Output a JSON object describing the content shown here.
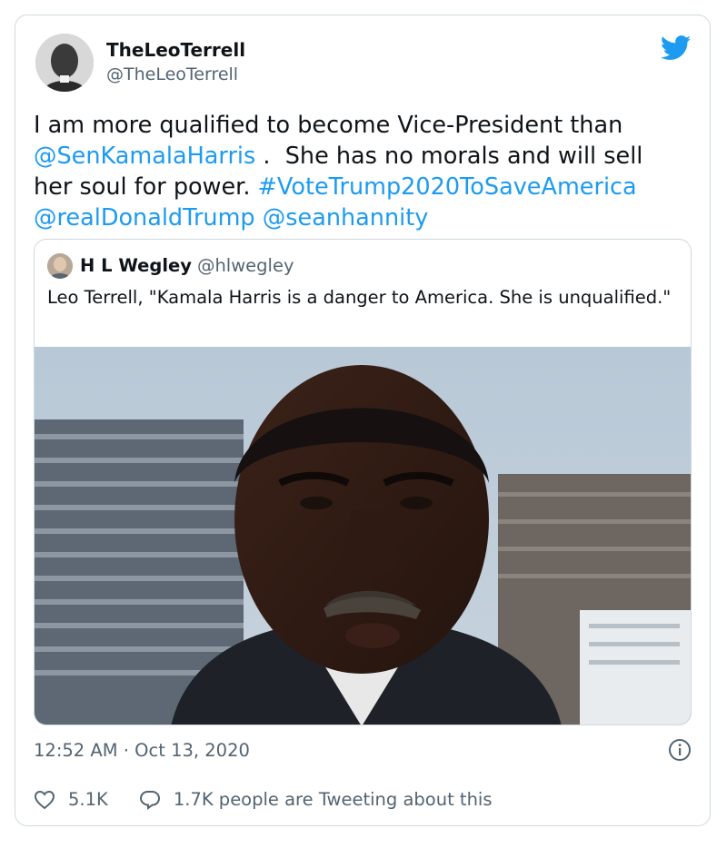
{
  "author": {
    "name": "TheLeoTerrell",
    "handle": "@TheLeoTerrell"
  },
  "tweet": {
    "text_1": "I am more qualified to become Vice-President than ",
    "mention_1": "@SenKamalaHarris",
    "text_2": " .  She has no morals and will sell her soul for power. ",
    "hashtag": "#VoteTrump2020ToSaveAmerica",
    "mention_2": "@realDonaldTrump",
    "mention_3": "@seanhannity"
  },
  "quoted": {
    "name": "H L Wegley",
    "handle": "@hlwegley",
    "text": "Leo Terrell, \"Kamala Harris is a danger to America. She is unqualified.\""
  },
  "meta": {
    "timestamp": "12:52 AM · Oct 13, 2020",
    "likes": "5.1K",
    "tweeting_about": "1.7K people are Tweeting about this"
  },
  "colors": {
    "link": "#1d9bf0",
    "secondary_text": "#536471",
    "border": "#cfd9de",
    "twitter_blue": "#1d9bf0"
  },
  "icons": {
    "brand": "twitter-bird-icon",
    "info": "info-icon",
    "like": "heart-icon",
    "reply": "speech-bubble-icon"
  }
}
